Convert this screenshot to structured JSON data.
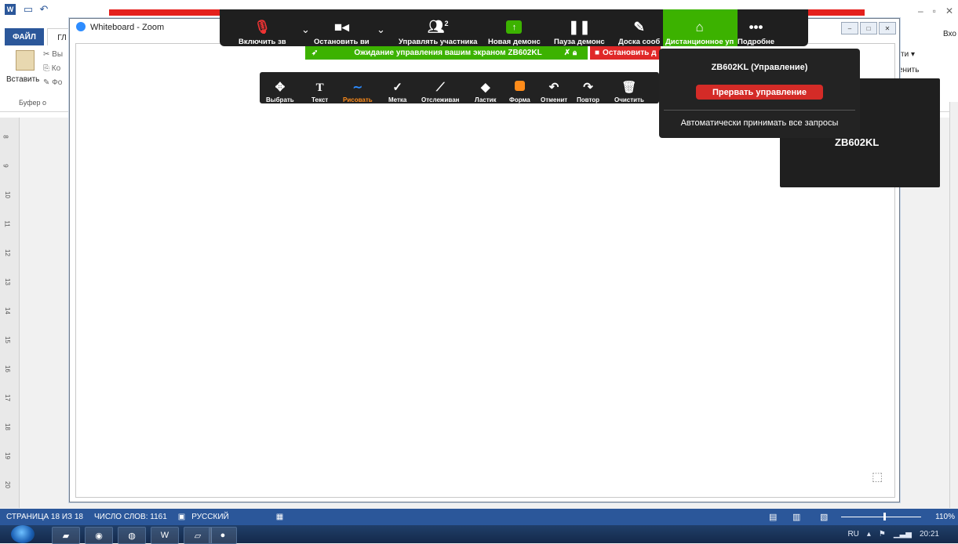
{
  "word": {
    "file_tab": "ФАЙЛ",
    "home_tab": "ГЛ",
    "account": "Вхо",
    "ribbon": {
      "cut": "Вы",
      "copy": "Ко",
      "paste": "Вставить",
      "format": "Фо",
      "clipboard_group": "Буфер о",
      "right_text1": "ти ▾",
      "right_text2": "енить"
    },
    "ruler_numbers": [
      "8",
      "9",
      "10",
      "11",
      "12",
      "13",
      "14",
      "15",
      "16",
      "17",
      "18",
      "19",
      "20"
    ],
    "status": {
      "page": "СТРАНИЦА 18 ИЗ 18",
      "words": "ЧИСЛО СЛОВ: 1161",
      "language": "РУССКИЙ",
      "zoom": "110%"
    }
  },
  "taskbar": {
    "lang": "RU",
    "time": "20:21"
  },
  "whiteboard": {
    "title": "Whiteboard - Zoom"
  },
  "zoom_toolbar": {
    "mute": "Включить зв",
    "video": "Остановить ви",
    "participants": "Управлять участника",
    "participants_count": "2",
    "new_share": "Новая демонс",
    "pause_share": "Пауза демонс",
    "whiteboard": "Доска сооб",
    "remote_control": "Дистанционное уп",
    "more": "Подробне"
  },
  "banner": {
    "waiting": "Ожидание управления вашим экраном ZB602KL",
    "stop": "Остановить д"
  },
  "annotate": {
    "select": "Выбрать",
    "text": "Текст",
    "draw": "Рисовать",
    "stamp": "Метка",
    "spotlight": "Отслеживан",
    "eraser": "Ластик",
    "format": "Форма",
    "undo": "Отменит",
    "redo": "Повтор",
    "clear": "Очистить"
  },
  "remote_popup": {
    "title": "ZB602KL (Управление)",
    "stop_button": "Прервать управление",
    "auto_accept": "Автоматически принимать все запросы"
  },
  "side_panel": {
    "name": "ZB602KL"
  },
  "colors": {
    "zoom_green": "#3cb200",
    "stop_red": "#d42b27",
    "word_blue": "#2b579a",
    "draw_accent": "#2d8cff",
    "format_orange": "#ff8c1a"
  }
}
